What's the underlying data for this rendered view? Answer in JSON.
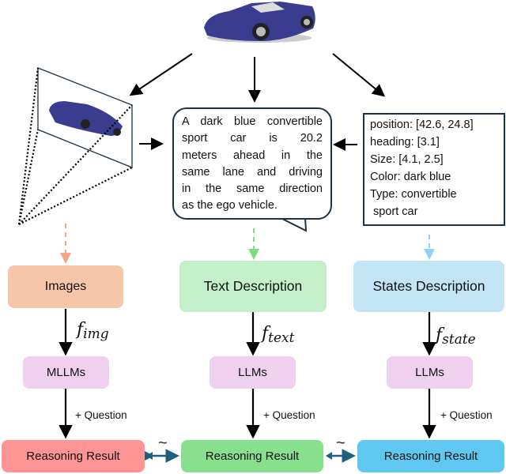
{
  "bubble_lines": [
    "A dark blue convertible",
    "sport car is 20.2",
    "meters ahead in the",
    "same lane and driving",
    "in the same direction",
    "as the ego vehicle."
  ],
  "states_lines": [
    "position: [42.6, 24.8]",
    "heading: [3.1]",
    "Size: [4.1, 2.5]",
    "Color: dark blue",
    "Type: convertible",
    " sport car"
  ],
  "columns": [
    {
      "input": "Images",
      "func": "f",
      "func_sub": "img",
      "model": "MLLMs",
      "question": "+ Question",
      "result": "Reasoning Result"
    },
    {
      "input": "Text Description",
      "func": "f",
      "func_sub": "text",
      "model": "LLMs",
      "question": "+ Question",
      "result": "Reasoning Result"
    },
    {
      "input": "States Description",
      "func": "f",
      "func_sub": "state",
      "model": "LLMs",
      "question": "+ Question",
      "result": "Reasoning Result"
    }
  ],
  "similarity_symbol": "~",
  "colors": {
    "images_box": "#f7c6a9",
    "text_box": "#c3f0c8",
    "states_box": "#c2e4f5",
    "model_box": "#f0d0ef",
    "result_images": "#ff9494",
    "result_text": "#88e08f",
    "result_states": "#5ec8f0",
    "double_arrow": "#1f5f80",
    "car": "#3a3d8f"
  }
}
